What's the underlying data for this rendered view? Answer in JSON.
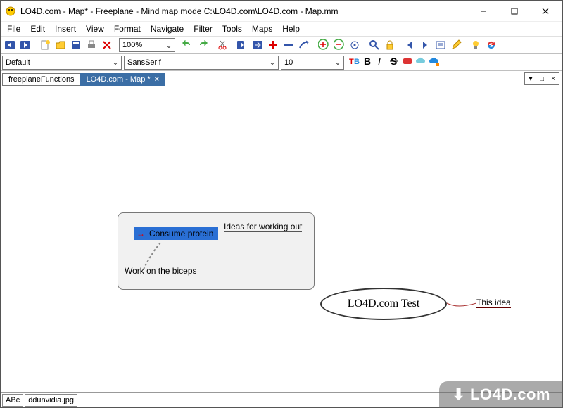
{
  "window": {
    "title": "LO4D.com - Map* - Freeplane - Mind map mode C:\\LO4D.com\\LO4D.com - Map.mm"
  },
  "menu": {
    "file": "File",
    "edit": "Edit",
    "insert": "Insert",
    "view": "View",
    "format": "Format",
    "navigate": "Navigate",
    "filter": "Filter",
    "tools": "Tools",
    "maps": "Maps",
    "help": "Help"
  },
  "combo": {
    "zoom": "100%",
    "style": "Default",
    "font": "SansSerif",
    "size": "10",
    "caret": "⌄"
  },
  "tabs": {
    "inactive": "freeplaneFunctions",
    "active": "LO4D.com - Map *",
    "close": "×",
    "right1": "▾",
    "right2": "□",
    "right3": "×"
  },
  "nodes": {
    "selected": "Consume protein",
    "ideas": "Ideas for working out",
    "biceps": "Work on the biceps",
    "oval": "LO4D.com Test",
    "thisidea": "This idea"
  },
  "status": {
    "abc": "ABc",
    "file": "ddunvidia.jpg"
  },
  "watermark": "⬇ LO4D.com"
}
